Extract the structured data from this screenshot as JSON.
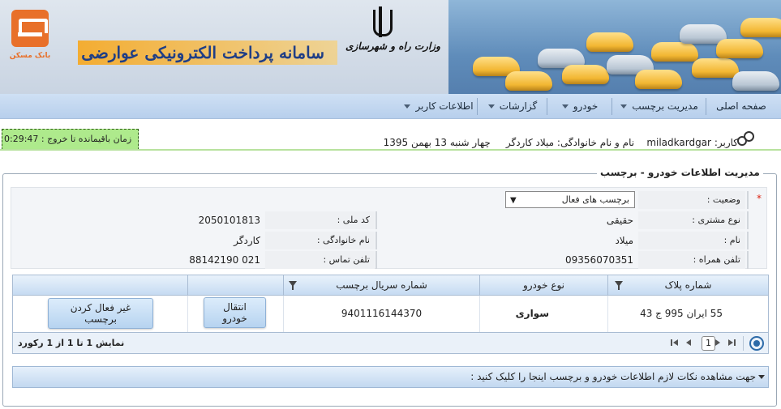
{
  "header": {
    "title": "سامانه پرداخت الکترونیکی عوارضی",
    "ministry": "وزارت راه و شهرسازی",
    "bank_name": "بانک مسکن",
    "emblem_icon": "iran-emblem-icon",
    "logo_icon": "bank-maskan-logo-icon",
    "accent_color": "#f2a53a",
    "title_color": "#1f3e86"
  },
  "menu": {
    "items": [
      {
        "label": "صفحه اصلی",
        "dropdown": false
      },
      {
        "label": "مدیریت برچسب",
        "dropdown": true
      },
      {
        "label": "خودرو",
        "dropdown": true
      },
      {
        "label": "گزارشات",
        "dropdown": true
      },
      {
        "label": "اطلاعات کاربر",
        "dropdown": true
      }
    ]
  },
  "session": {
    "timer_label": "زمان باقیمانده تا خروج :",
    "timer_value": "0:29:47",
    "timer_color": "#aeea8c",
    "user_label": "کاربر:",
    "username": "miladkardgar",
    "fullname_label": "نام و نام خانوادگی:",
    "fullname": "میلاد  کاردگر",
    "date": "چهار شنبه 13 بهمن 1395"
  },
  "panel": {
    "legend": "مدیریت اطلاعات خودرو - برچسب",
    "form": {
      "status_label": "وضعیت :",
      "status_value": "برچسب های فعال",
      "customer_type_label": "نوع مشتری :",
      "customer_type_value": "حقیقی",
      "national_id_label": "کد ملی :",
      "national_id_value": "2050101813",
      "first_name_label": "نام :",
      "first_name_value": "میلاد",
      "last_name_label": "نام خانوادگی :",
      "last_name_value": "کاردگر",
      "mobile_label": "تلفن همراه :",
      "mobile_value": "09356070351",
      "phone_label": "تلفن تماس :",
      "phone_value": "021 88142190",
      "required_mark": "*"
    },
    "grid": {
      "columns": [
        "شماره پلاک",
        "نوع خودرو",
        "شماره سریال برچسب",
        ""
      ],
      "rows": [
        {
          "plate": "55  ایران  995   ج   43",
          "vehicle_type": "سواری",
          "serial": "9401116144370",
          "transfer_button": "انتقال خودرو",
          "deactivate_button": "غیر فعال کردن برچسب"
        }
      ],
      "current_page": "1",
      "page_info": "نمایش 1 تا 1 از 1 رکورد"
    },
    "info_bar": "جهت مشاهده نکات لازم اطلاعات خودرو و برچسب اینجا را کلیک کنید :"
  }
}
